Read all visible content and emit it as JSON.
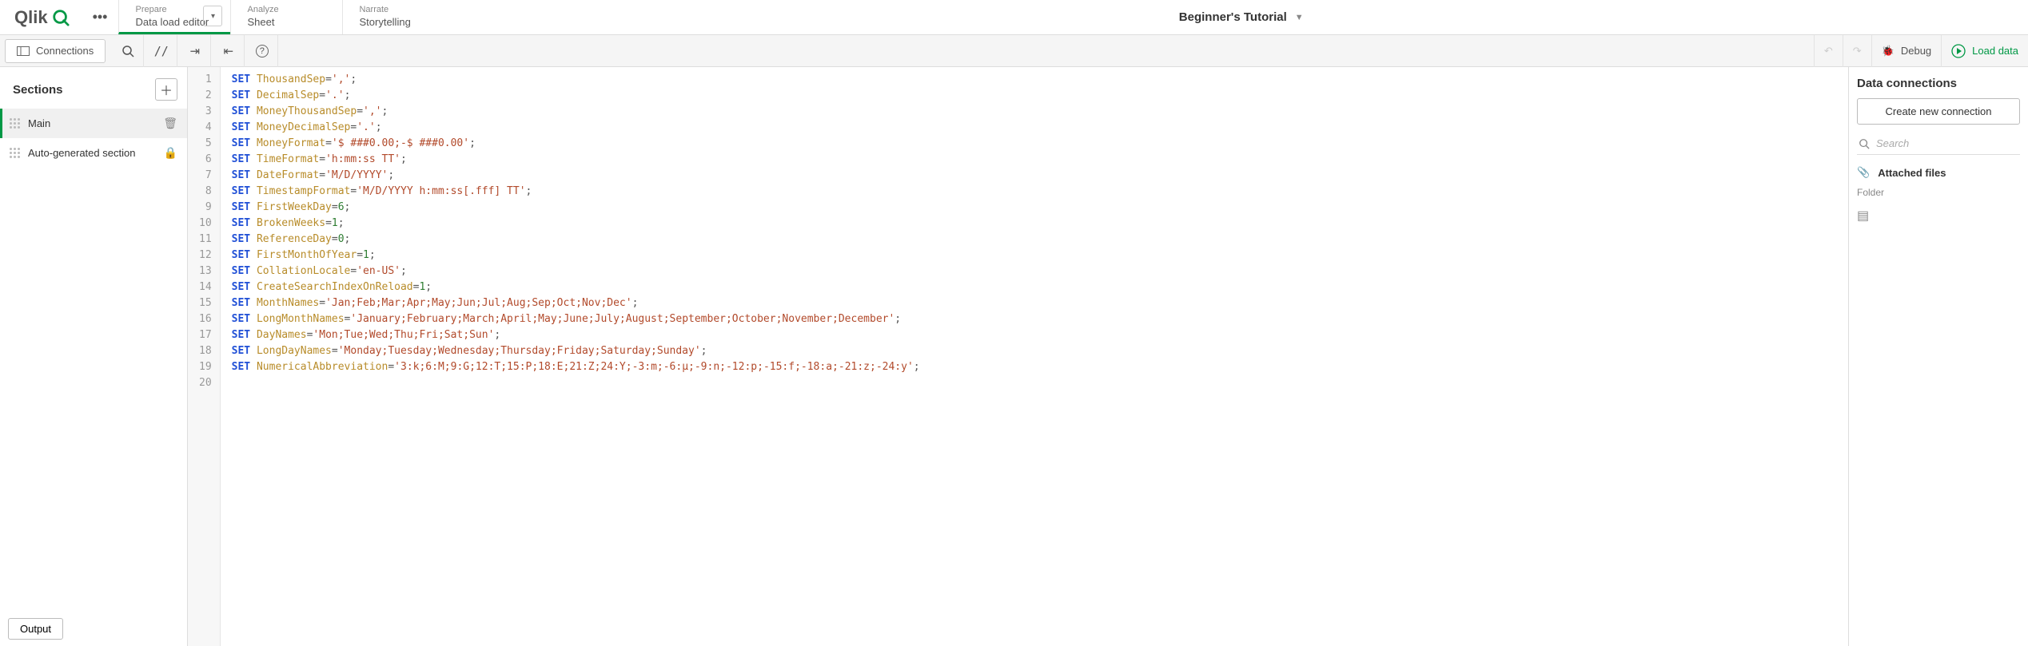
{
  "app_name": "Beginner's Tutorial",
  "logo_text": "Qlik",
  "tabs": [
    {
      "sup": "Prepare",
      "sub": "Data load editor",
      "active": true,
      "dropdown": true
    },
    {
      "sup": "Analyze",
      "sub": "Sheet",
      "active": false,
      "dropdown": false
    },
    {
      "sup": "Narrate",
      "sub": "Storytelling",
      "active": false,
      "dropdown": false
    }
  ],
  "toolbar": {
    "connections_label": "Connections",
    "debug_label": "Debug",
    "load_label": "Load data"
  },
  "sections": {
    "title": "Sections",
    "items": [
      {
        "label": "Main",
        "tail": "trash",
        "active": true
      },
      {
        "label": "Auto-generated section",
        "tail": "lock",
        "active": false
      }
    ],
    "output_label": "Output"
  },
  "code_lines": [
    [
      [
        "kw",
        "SET"
      ],
      [
        "pl",
        " "
      ],
      [
        "vr",
        "ThousandSep"
      ],
      [
        "pl",
        "="
      ],
      [
        "st",
        "','"
      ],
      [
        "pl",
        ";"
      ]
    ],
    [
      [
        "kw",
        "SET"
      ],
      [
        "pl",
        " "
      ],
      [
        "vr",
        "DecimalSep"
      ],
      [
        "pl",
        "="
      ],
      [
        "st",
        "'.'"
      ],
      [
        "pl",
        ";"
      ]
    ],
    [
      [
        "kw",
        "SET"
      ],
      [
        "pl",
        " "
      ],
      [
        "vr",
        "MoneyThousandSep"
      ],
      [
        "pl",
        "="
      ],
      [
        "st",
        "','"
      ],
      [
        "pl",
        ";"
      ]
    ],
    [
      [
        "kw",
        "SET"
      ],
      [
        "pl",
        " "
      ],
      [
        "vr",
        "MoneyDecimalSep"
      ],
      [
        "pl",
        "="
      ],
      [
        "st",
        "'.'"
      ],
      [
        "pl",
        ";"
      ]
    ],
    [
      [
        "kw",
        "SET"
      ],
      [
        "pl",
        " "
      ],
      [
        "vr",
        "MoneyFormat"
      ],
      [
        "pl",
        "="
      ],
      [
        "st",
        "'$ ###0.00;-$ ###0.00'"
      ],
      [
        "pl",
        ";"
      ]
    ],
    [
      [
        "kw",
        "SET"
      ],
      [
        "pl",
        " "
      ],
      [
        "vr",
        "TimeFormat"
      ],
      [
        "pl",
        "="
      ],
      [
        "st",
        "'h:mm:ss TT'"
      ],
      [
        "pl",
        ";"
      ]
    ],
    [
      [
        "kw",
        "SET"
      ],
      [
        "pl",
        " "
      ],
      [
        "vr",
        "DateFormat"
      ],
      [
        "pl",
        "="
      ],
      [
        "st",
        "'M/D/YYYY'"
      ],
      [
        "pl",
        ";"
      ]
    ],
    [
      [
        "kw",
        "SET"
      ],
      [
        "pl",
        " "
      ],
      [
        "vr",
        "TimestampFormat"
      ],
      [
        "pl",
        "="
      ],
      [
        "st",
        "'M/D/YYYY h:mm:ss[.fff] TT'"
      ],
      [
        "pl",
        ";"
      ]
    ],
    [
      [
        "kw",
        "SET"
      ],
      [
        "pl",
        " "
      ],
      [
        "vr",
        "FirstWeekDay"
      ],
      [
        "pl",
        "="
      ],
      [
        "nm",
        "6"
      ],
      [
        "pl",
        ";"
      ]
    ],
    [
      [
        "kw",
        "SET"
      ],
      [
        "pl",
        " "
      ],
      [
        "vr",
        "BrokenWeeks"
      ],
      [
        "pl",
        "="
      ],
      [
        "nm",
        "1"
      ],
      [
        "pl",
        ";"
      ]
    ],
    [
      [
        "kw",
        "SET"
      ],
      [
        "pl",
        " "
      ],
      [
        "vr",
        "ReferenceDay"
      ],
      [
        "pl",
        "="
      ],
      [
        "nm",
        "0"
      ],
      [
        "pl",
        ";"
      ]
    ],
    [
      [
        "kw",
        "SET"
      ],
      [
        "pl",
        " "
      ],
      [
        "vr",
        "FirstMonthOfYear"
      ],
      [
        "pl",
        "="
      ],
      [
        "nm",
        "1"
      ],
      [
        "pl",
        ";"
      ]
    ],
    [
      [
        "kw",
        "SET"
      ],
      [
        "pl",
        " "
      ],
      [
        "vr",
        "CollationLocale"
      ],
      [
        "pl",
        "="
      ],
      [
        "st",
        "'en-US'"
      ],
      [
        "pl",
        ";"
      ]
    ],
    [
      [
        "kw",
        "SET"
      ],
      [
        "pl",
        " "
      ],
      [
        "vr",
        "CreateSearchIndexOnReload"
      ],
      [
        "pl",
        "="
      ],
      [
        "nm",
        "1"
      ],
      [
        "pl",
        ";"
      ]
    ],
    [
      [
        "kw",
        "SET"
      ],
      [
        "pl",
        " "
      ],
      [
        "vr",
        "MonthNames"
      ],
      [
        "pl",
        "="
      ],
      [
        "st",
        "'Jan;Feb;Mar;Apr;May;Jun;Jul;Aug;Sep;Oct;Nov;Dec'"
      ],
      [
        "pl",
        ";"
      ]
    ],
    [
      [
        "kw",
        "SET"
      ],
      [
        "pl",
        " "
      ],
      [
        "vr",
        "LongMonthNames"
      ],
      [
        "pl",
        "="
      ],
      [
        "st",
        "'January;February;March;April;May;June;July;August;September;October;November;December'"
      ],
      [
        "pl",
        ";"
      ]
    ],
    [
      [
        "kw",
        "SET"
      ],
      [
        "pl",
        " "
      ],
      [
        "vr",
        "DayNames"
      ],
      [
        "pl",
        "="
      ],
      [
        "st",
        "'Mon;Tue;Wed;Thu;Fri;Sat;Sun'"
      ],
      [
        "pl",
        ";"
      ]
    ],
    [
      [
        "kw",
        "SET"
      ],
      [
        "pl",
        " "
      ],
      [
        "vr",
        "LongDayNames"
      ],
      [
        "pl",
        "="
      ],
      [
        "st",
        "'Monday;Tuesday;Wednesday;Thursday;Friday;Saturday;Sunday'"
      ],
      [
        "pl",
        ";"
      ]
    ],
    [
      [
        "kw",
        "SET"
      ],
      [
        "pl",
        " "
      ],
      [
        "vr",
        "NumericalAbbreviation"
      ],
      [
        "pl",
        "="
      ],
      [
        "st",
        "'3:k;6:M;9:G;12:T;15:P;18:E;21:Z;24:Y;-3:m;-6:μ;-9:n;-12:p;-15:f;-18:a;-21:z;-24:y'"
      ],
      [
        "pl",
        ";"
      ]
    ],
    []
  ],
  "data_connections": {
    "title": "Data connections",
    "create_label": "Create new connection",
    "search_placeholder": "Search",
    "attached_label": "Attached files",
    "folder_label": "Folder"
  }
}
